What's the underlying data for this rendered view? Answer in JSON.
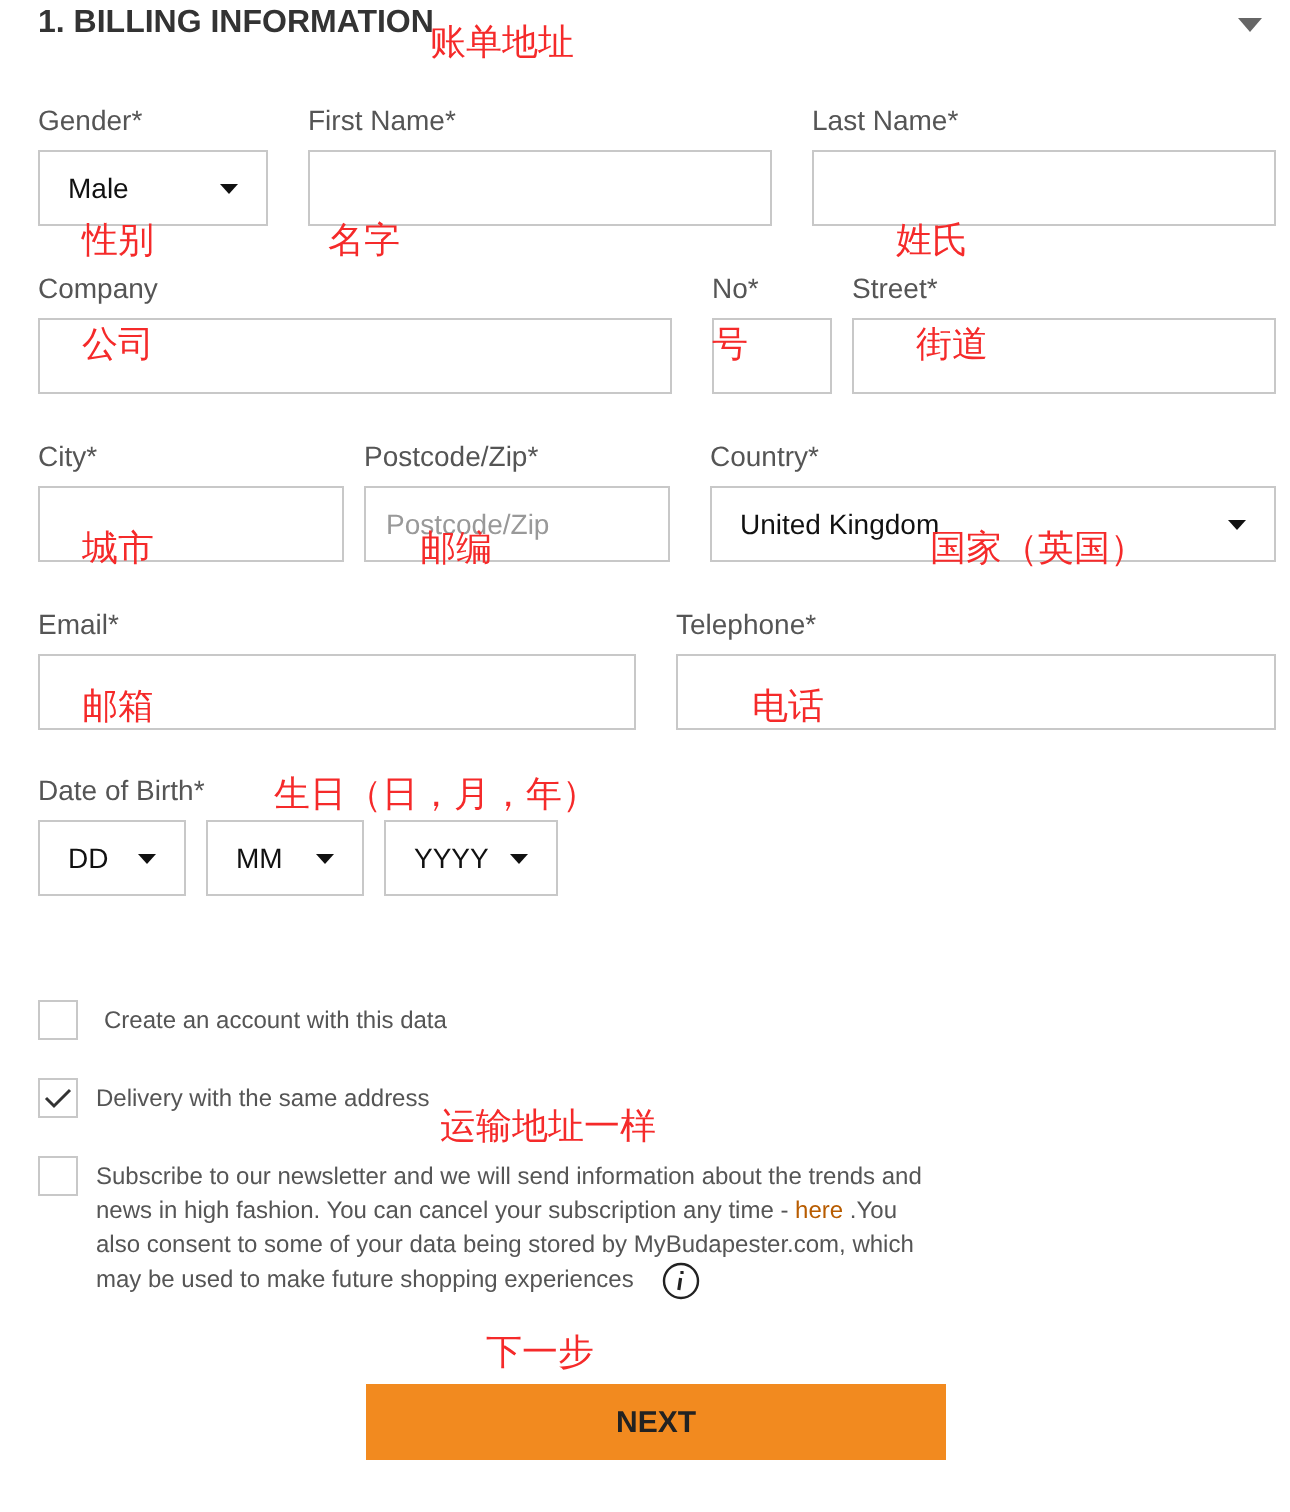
{
  "header": {
    "title": "1. BILLING INFORMATION",
    "expanded": true,
    "note": "账单地址"
  },
  "rows": [
    [
      {
        "label": "Gender*",
        "kind": "select",
        "value": "Male",
        "note": "性别"
      },
      {
        "label": "First Name*",
        "kind": "text",
        "note": "名字"
      },
      {
        "label": "Last Name*",
        "kind": "text",
        "note": "姓氏"
      }
    ],
    [
      {
        "label": "Company",
        "kind": "text",
        "note": "公司"
      },
      {
        "label": "No*",
        "kind": "text",
        "note": "号"
      },
      {
        "label": "Street*",
        "kind": "text",
        "note": "街道"
      }
    ],
    [
      {
        "label": "City*",
        "kind": "text",
        "note": "城市"
      },
      {
        "label": "Postcode/Zip*",
        "kind": "text",
        "placeholder": "Postcode/Zip",
        "note": "邮编"
      },
      {
        "label": "Country*",
        "kind": "select",
        "value": "United Kingdom",
        "note": "国家（英国）"
      }
    ],
    [
      {
        "label": "Email*",
        "kind": "text",
        "note": "邮箱"
      },
      {
        "label": "Telephone*",
        "kind": "text",
        "note": "电话"
      }
    ]
  ],
  "birth": {
    "label": "Date of Birth*",
    "note": "生日（日，月，年）",
    "selects": [
      "DD",
      "MM",
      "YYYY"
    ]
  },
  "options": [
    {
      "text": "Create an account with this data",
      "checked": false
    },
    {
      "text": "Delivery with the same address",
      "checked": true,
      "note": "运输地址一样"
    },
    {
      "text": "Subscribe to our newsletter and we will send information about the trends and news in high fashion. You can cancel your subscription any time -",
      "link": "here",
      "text_after": ".You also consent to some of your data being stored by MyBudapester.com, which may be used to make future shopping experiences",
      "checked": false,
      "info": true
    }
  ],
  "button": {
    "label": "NEXT",
    "note": "下一步"
  }
}
